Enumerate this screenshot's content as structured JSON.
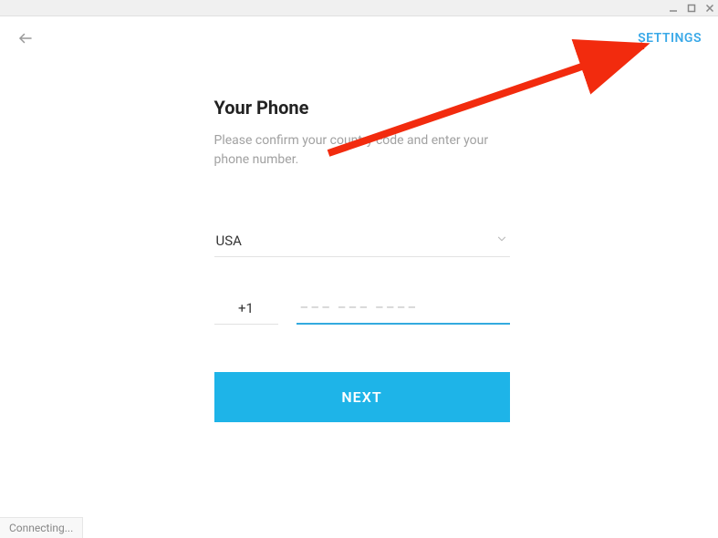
{
  "topbar": {
    "settings_label": "SETTINGS"
  },
  "form": {
    "title": "Your Phone",
    "subtitle": "Please confirm your country code and enter your phone number.",
    "country": "USA",
    "code_value": "+1",
    "phone_placeholder": "––– ––– ––––",
    "next_label": "NEXT"
  },
  "status": {
    "text": "Connecting..."
  },
  "colors": {
    "accent": "#1eb4e8",
    "link": "#3aa9e8",
    "arrow": "#f22b0e"
  }
}
